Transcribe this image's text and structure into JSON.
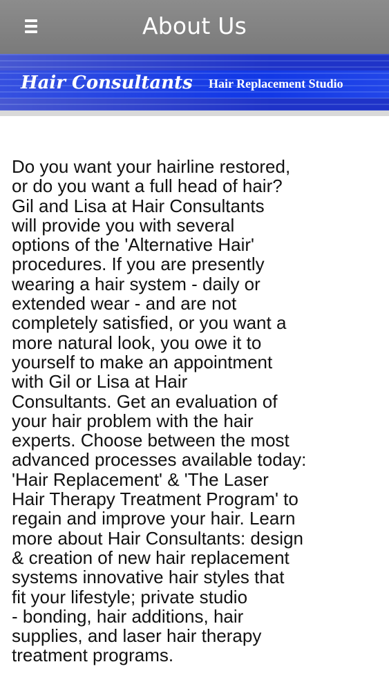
{
  "header": {
    "title": "About Us",
    "menu_icon": "hamburger-menu-icon"
  },
  "banner": {
    "brand": "Hair Consultants",
    "tagline": "Hair Replacement Studio"
  },
  "main": {
    "body_text": "Do you want your hairline restored,\nor do you want a full head of hair?\nGil and Lisa at Hair Consultants\nwill provide you with several\noptions of the 'Alternative Hair'\nprocedures. If you are presently\nwearing a hair system - daily or\nextended wear - and are not\ncompletely satisfied, or you want a\nmore natural look, you owe it to\nyourself to make an appointment\nwith Gil or Lisa at Hair\nConsultants. Get an evaluation of\nyour hair problem with the hair\nexperts. Choose between the most\nadvanced processes available today:\n'Hair Replacement' & 'The Laser\nHair Therapy Treatment Program' to\nregain and improve your hair. Learn\nmore about Hair Consultants: design\n& creation of new hair replacement\nsystems innovative hair styles that\nfit your lifestyle; private studio\n- bonding, hair additions, hair\nsupplies, and laser hair therapy\ntreatment programs."
  },
  "colors": {
    "topbar": "#808080",
    "banner": "#0d34e6",
    "text": "#111111"
  }
}
